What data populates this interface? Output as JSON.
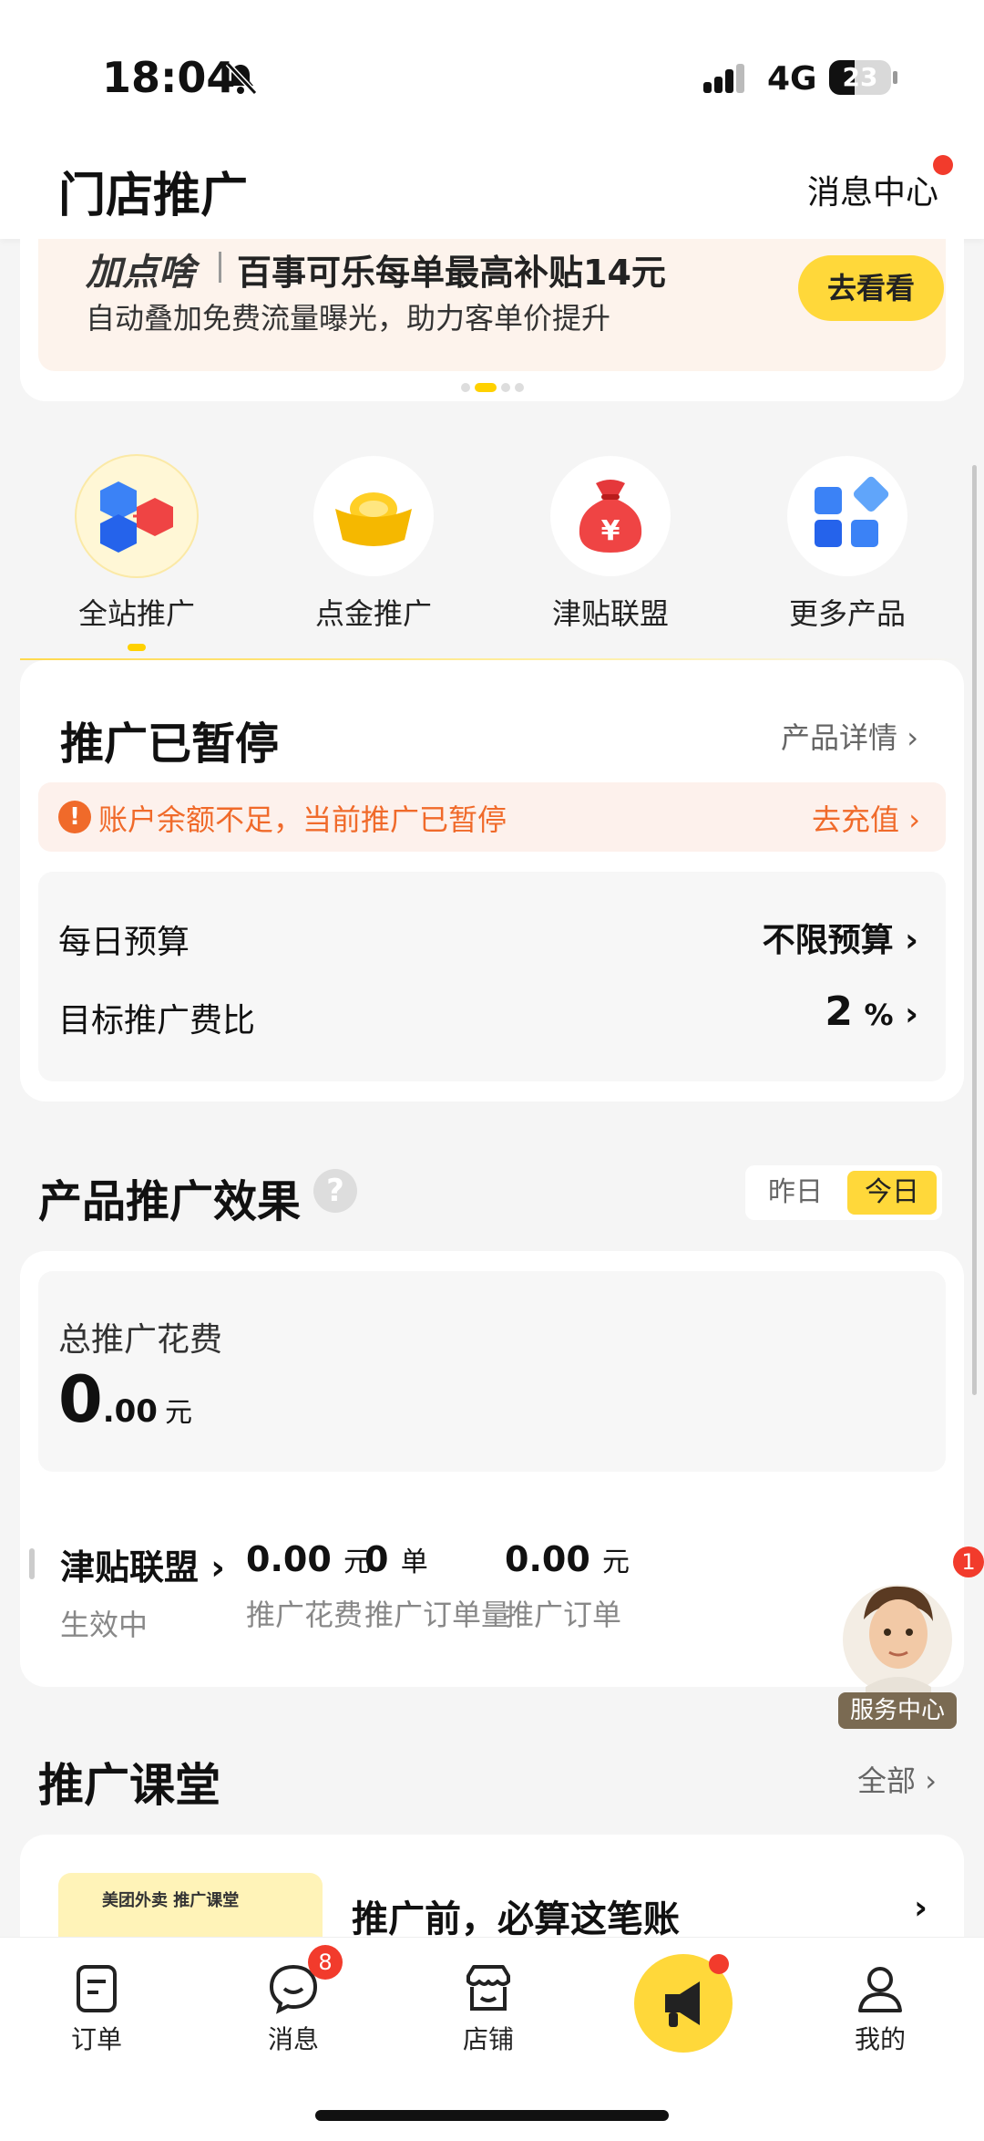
{
  "status_bar": {
    "time": "18:04",
    "network": "4G",
    "battery": "23"
  },
  "header": {
    "title": "门店推广",
    "message_center": "消息中心"
  },
  "banner": {
    "brand": "加点啥",
    "title": "百事可乐每单最高补贴14元",
    "subtitle": "自动叠加免费流量曝光，助力客单价提升",
    "button": "去看看"
  },
  "products": [
    {
      "label": "全站推广",
      "icon": "cubes-icon",
      "active": true
    },
    {
      "label": "点金推广",
      "icon": "gold-ingot-icon",
      "active": false
    },
    {
      "label": "津贴联盟",
      "icon": "money-bag-icon",
      "active": false
    },
    {
      "label": "更多产品",
      "icon": "grid-icon",
      "active": false
    }
  ],
  "status_card": {
    "title": "推广已暂停",
    "detail_link": "产品详情",
    "alert_text": "账户余额不足，当前推广已暂停",
    "alert_link": "去充值",
    "daily_budget_label": "每日预算",
    "daily_budget_value": "不限预算",
    "target_ratio_label": "目标推广费比",
    "target_ratio_value": "2",
    "target_ratio_unit": "%"
  },
  "effect": {
    "title": "产品推广效果",
    "help": "?",
    "tabs": [
      "昨日",
      "今日"
    ],
    "active_tab": "今日",
    "total_label": "总推广花费",
    "total_int": "0",
    "total_dec": ".00",
    "total_unit": "元",
    "row": {
      "name": "津贴联盟",
      "status": "生效中",
      "stats": [
        {
          "value": "0.00",
          "unit": "元",
          "label": "推广花费"
        },
        {
          "value": "0",
          "unit": "单",
          "label": "推广订单量"
        },
        {
          "value": "0.00",
          "unit": "元",
          "label": "推广订单"
        }
      ]
    }
  },
  "service": {
    "label": "服务中心",
    "badge": "1"
  },
  "course": {
    "title": "推广课堂",
    "all": "全部",
    "thumb_text": "美团外卖  推广课堂",
    "item_title": "推广前，必算这笔账"
  },
  "bottom_nav": {
    "items": [
      {
        "label": "订单",
        "icon": "order-icon"
      },
      {
        "label": "消息",
        "icon": "message-icon",
        "badge": "8"
      },
      {
        "label": "店铺",
        "icon": "store-icon"
      },
      {
        "label": "",
        "icon": "megaphone-icon"
      },
      {
        "label": "我的",
        "icon": "profile-icon"
      }
    ]
  },
  "colors": {
    "accent": "#ffd83a",
    "alert": "#f06a2a",
    "badge": "#f23b2c"
  }
}
